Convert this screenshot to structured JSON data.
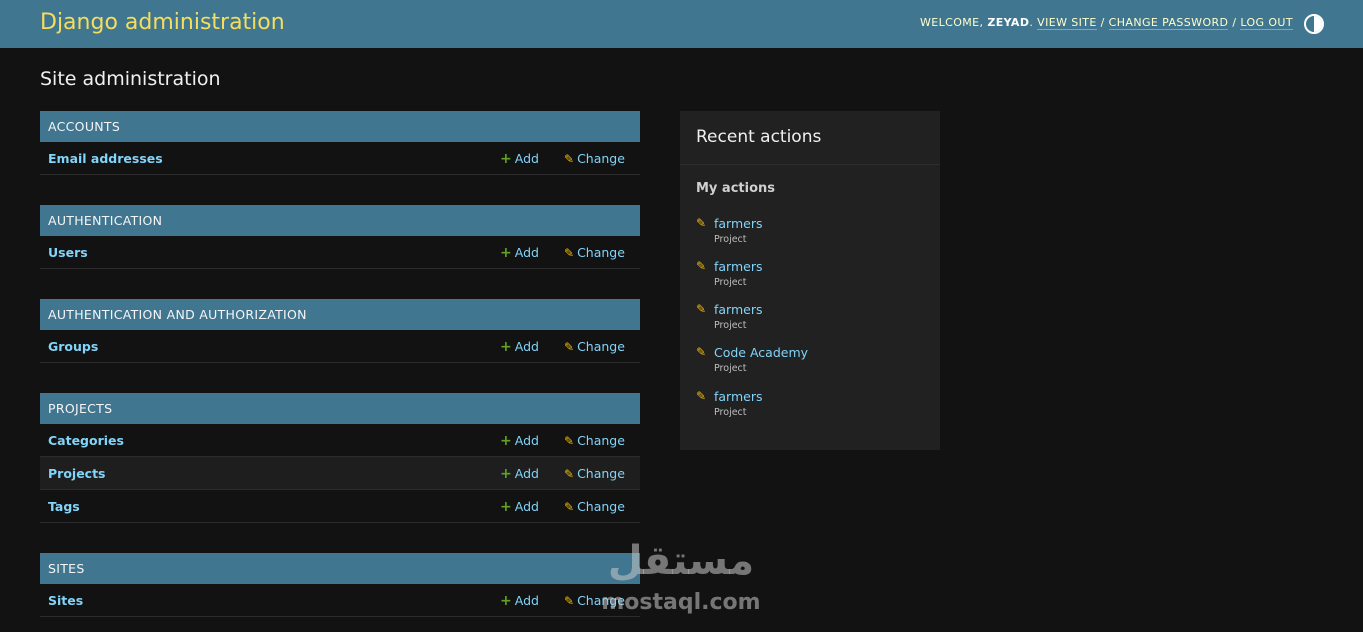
{
  "header": {
    "brand": "Django administration",
    "welcome": "Welcome,",
    "username": "zeyad",
    "view_site": "View site",
    "change_password": "Change password",
    "log_out": "Log out",
    "separator": "/",
    "theme_icon": "contrast-toggle-icon"
  },
  "page": {
    "title": "Site administration"
  },
  "labels": {
    "add": "Add",
    "change": "Change",
    "add_icon": "+",
    "change_icon": "✎"
  },
  "modules": [
    {
      "caption": "Accounts",
      "models": [
        "Email addresses"
      ]
    },
    {
      "caption": "Authentication",
      "models": [
        "Users"
      ]
    },
    {
      "caption": "Authentication and Authorization",
      "models": [
        "Groups"
      ]
    },
    {
      "caption": "Projects",
      "models": [
        "Categories",
        "Projects",
        "Tags"
      ]
    },
    {
      "caption": "Sites",
      "models": [
        "Sites"
      ]
    }
  ],
  "recent": {
    "title": "Recent actions",
    "my_actions": "My actions",
    "items": [
      {
        "name": "farmers",
        "type": "Project"
      },
      {
        "name": "farmers",
        "type": "Project"
      },
      {
        "name": "farmers",
        "type": "Project"
      },
      {
        "name": "Code Academy",
        "type": "Project"
      },
      {
        "name": "farmers",
        "type": "Project"
      }
    ]
  },
  "watermark": {
    "arabic": "مستقل",
    "latin": "mostaql.com"
  },
  "colors": {
    "header_bg": "#417690",
    "brand": "#f5dd5d",
    "link": "#81d4fa",
    "add_icon": "#5fa225",
    "change_icon": "#efb80b",
    "body_bg": "#121212"
  }
}
